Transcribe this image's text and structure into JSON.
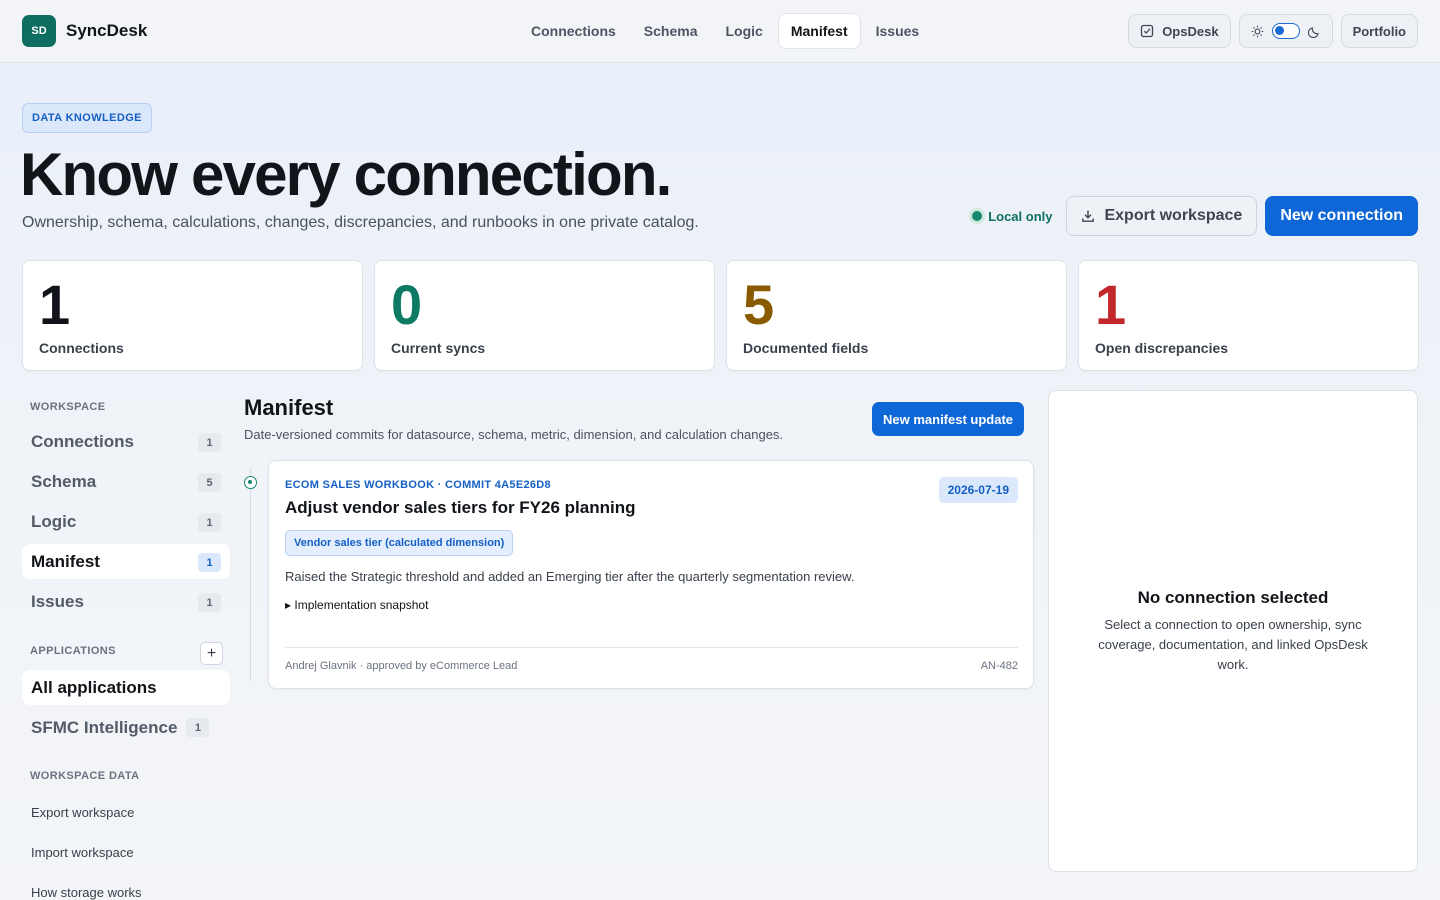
{
  "app": {
    "logo_initials": "SD",
    "name": "SyncDesk"
  },
  "nav": {
    "items": [
      {
        "label": "Connections"
      },
      {
        "label": "Schema"
      },
      {
        "label": "Logic"
      },
      {
        "label": "Manifest",
        "active": true
      },
      {
        "label": "Issues"
      }
    ],
    "opsdesk_label": "OpsDesk",
    "portfolio_label": "Portfolio"
  },
  "hero": {
    "eyebrow": "DATA KNOWLEDGE",
    "title": "Know every connection.",
    "subtitle": "Ownership, schema, calculations, changes, discrepancies, and runbooks in one private catalog.",
    "status": "Local only",
    "export_label": "Export workspace",
    "new_label": "New connection"
  },
  "stats": [
    {
      "value": "1",
      "label": "Connections",
      "color": "#111418"
    },
    {
      "value": "0",
      "label": "Current syncs",
      "color": "#0e7a63"
    },
    {
      "value": "5",
      "label": "Documented fields",
      "color": "#8a5a00"
    },
    {
      "value": "1",
      "label": "Open discrepancies",
      "color": "#c2282b"
    }
  ],
  "sidebar": {
    "workspace_heading": "WORKSPACE",
    "items": [
      {
        "label": "Connections",
        "count": "1"
      },
      {
        "label": "Schema",
        "count": "5"
      },
      {
        "label": "Logic",
        "count": "1"
      },
      {
        "label": "Manifest",
        "count": "1",
        "active": true
      },
      {
        "label": "Issues",
        "count": "1"
      }
    ],
    "applications_heading": "APPLICATIONS",
    "add_label": "+",
    "applications": [
      {
        "label": "All applications",
        "active": true
      },
      {
        "label": "SFMC Intelligence",
        "count": "1"
      }
    ],
    "data_heading": "WORKSPACE DATA",
    "data_links": [
      {
        "label": "Export workspace"
      },
      {
        "label": "Import workspace"
      },
      {
        "label": "How storage works"
      }
    ]
  },
  "manifest": {
    "title": "Manifest",
    "subtitle": "Date-versioned commits for datasource, schema, metric, dimension, and calculation changes.",
    "new_button": "New manifest update",
    "entry": {
      "eyebrow": "ECOM SALES WORKBOOK · COMMIT 4A5E26D8",
      "date": "2026-07-19",
      "title": "Adjust vendor sales tiers for FY26 planning",
      "tag": "Vendor sales tier (calculated dimension)",
      "description": "Raised the Strategic threshold and added an Emerging tier after the quarterly segmentation review.",
      "snapshot": "▸ Implementation snapshot",
      "footer": "Andrej Glavnik · approved by eCommerce Lead",
      "reference": "AN-482"
    }
  },
  "panel": {
    "title": "No connection selected",
    "text": "Select a connection to open ownership, sync coverage, documentation, and linked OpsDesk work."
  }
}
